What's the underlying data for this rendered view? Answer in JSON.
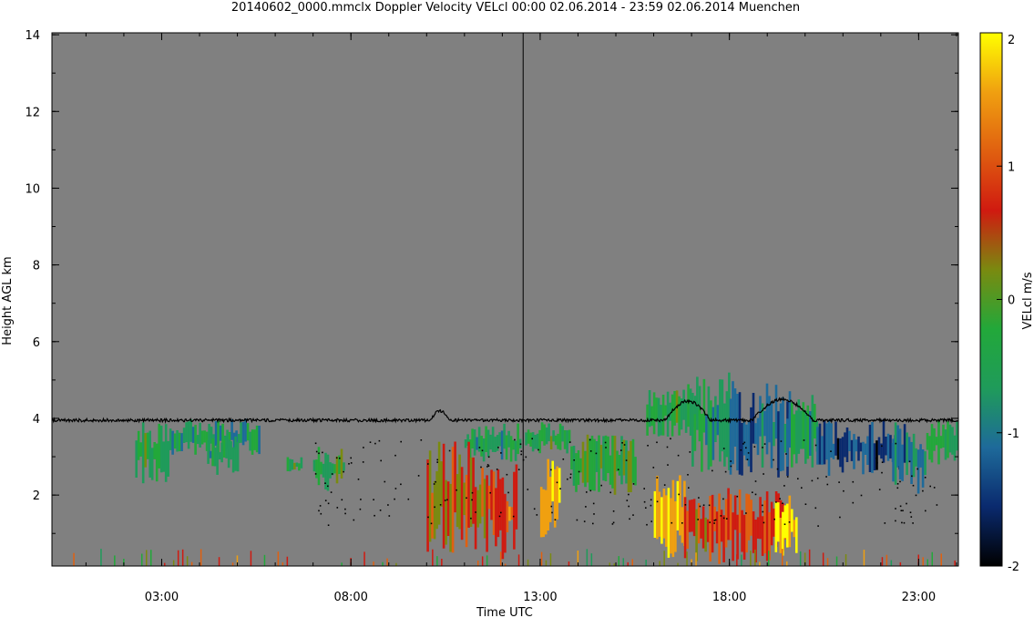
{
  "chart_data": {
    "type": "heatmap",
    "title": "20140602_0000.mmclx Doppler Velocity VELcl   00:00 02.06.2014 - 23:59 02.06.2014 Muenchen",
    "xlabel": "Time UTC",
    "ylabel": "Height AGL km",
    "colorbar_label": "VELcl m/s",
    "x_ticks": [
      "03:00",
      "08:00",
      "13:00",
      "18:00",
      "23:00"
    ],
    "x_tick_hours": [
      3,
      8,
      13,
      18,
      23
    ],
    "xlim_hours": [
      0.1,
      24.05
    ],
    "y_ticks": [
      2,
      4,
      6,
      8,
      10,
      12,
      14
    ],
    "ylim": [
      0.15,
      14.05
    ],
    "colorbar_ticks": [
      -2,
      -1,
      0,
      1,
      2
    ],
    "colorbar_range": [
      -2,
      2
    ],
    "grid": false,
    "legend": "colorbar right",
    "colormap": [
      "#000000",
      "#0a2a6e",
      "#1e6a9a",
      "#1f9b5a",
      "#22a83a",
      "#7a8a10",
      "#d01a10",
      "#e06010",
      "#f0a010",
      "#ffff00"
    ],
    "background_color": "#808080",
    "cloud_top_line_km": 3.95,
    "spike_hour": 12.55,
    "spike_top_km": 14.05,
    "echo_regions": [
      {
        "t0": 2.3,
        "t1": 3.2,
        "h0": 2.3,
        "h1": 3.9,
        "vel": -0.4
      },
      {
        "t0": 3.2,
        "t1": 5.6,
        "h0": 3.0,
        "h1": 4.0,
        "vel": -0.6
      },
      {
        "t0": 4.2,
        "t1": 5.0,
        "h0": 2.5,
        "h1": 3.6,
        "vel": -0.5
      },
      {
        "t0": 6.3,
        "t1": 6.7,
        "h0": 2.6,
        "h1": 3.0,
        "vel": -0.4
      },
      {
        "t0": 7.0,
        "t1": 7.8,
        "h0": 2.1,
        "h1": 3.3,
        "vel": -0.3
      },
      {
        "t0": 11.0,
        "t1": 12.5,
        "h0": 2.8,
        "h1": 3.9,
        "vel": -0.5
      },
      {
        "t0": 12.6,
        "t1": 13.8,
        "h0": 3.0,
        "h1": 3.9,
        "vel": -0.4
      },
      {
        "t0": 13.8,
        "t1": 15.5,
        "h0": 2.0,
        "h1": 3.6,
        "vel": -0.2
      },
      {
        "t0": 15.8,
        "t1": 17.2,
        "h0": 3.5,
        "h1": 4.9,
        "vel": -0.4
      },
      {
        "t0": 17.0,
        "t1": 18.0,
        "h0": 2.5,
        "h1": 5.2,
        "vel": -0.7
      },
      {
        "t0": 18.0,
        "t1": 19.6,
        "h0": 2.4,
        "h1": 5.0,
        "vel": -1.2
      },
      {
        "t0": 19.5,
        "t1": 20.3,
        "h0": 2.7,
        "h1": 4.8,
        "vel": -0.6
      },
      {
        "t0": 20.3,
        "t1": 22.5,
        "h0": 2.5,
        "h1": 4.0,
        "vel": -1.5
      },
      {
        "t0": 22.3,
        "t1": 23.2,
        "h0": 2.0,
        "h1": 4.0,
        "vel": -1.1
      },
      {
        "t0": 23.2,
        "t1": 24.0,
        "h0": 2.8,
        "h1": 4.1,
        "vel": -0.3
      },
      {
        "t0": 10.0,
        "t1": 11.8,
        "h0": 0.4,
        "h1": 3.4,
        "vel": 0.5
      },
      {
        "t0": 11.8,
        "t1": 12.4,
        "h0": 0.2,
        "h1": 2.8,
        "vel": 0.9
      },
      {
        "t0": 13.0,
        "t1": 13.5,
        "h0": 0.9,
        "h1": 3.1,
        "vel": 1.8
      },
      {
        "t0": 16.0,
        "t1": 16.8,
        "h0": 0.3,
        "h1": 2.6,
        "vel": 1.9
      },
      {
        "t0": 16.8,
        "t1": 19.5,
        "h0": 0.2,
        "h1": 2.2,
        "vel": 0.8
      },
      {
        "t0": 19.2,
        "t1": 19.8,
        "h0": 0.3,
        "h1": 2.0,
        "vel": 2.0
      }
    ]
  }
}
